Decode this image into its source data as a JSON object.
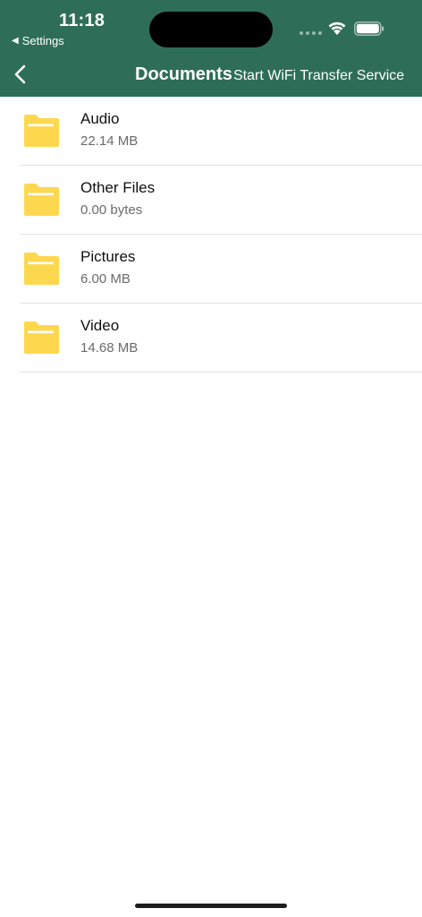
{
  "status_bar": {
    "time": "11:18",
    "back_app": "Settings",
    "back_glyph": "◀"
  },
  "nav": {
    "title": "Documents",
    "action_label": "Start WiFi Transfer Service",
    "back_icon": "chevron-left-icon"
  },
  "colors": {
    "header_bg": "#2e6e59",
    "folder_yellow": "#fdd84f"
  },
  "items": [
    {
      "name": "Audio",
      "size": "22.14 MB"
    },
    {
      "name": "Other Files",
      "size": "0.00 bytes"
    },
    {
      "name": "Pictures",
      "size": "6.00 MB"
    },
    {
      "name": "Video",
      "size": "14.68 MB"
    }
  ]
}
